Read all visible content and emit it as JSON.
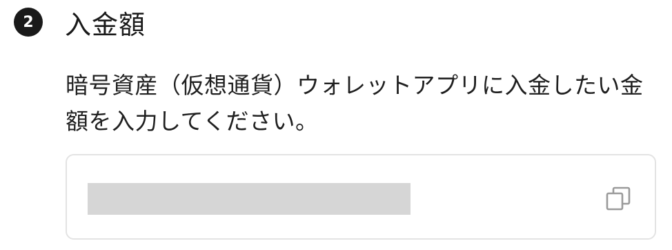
{
  "step": {
    "number": "2",
    "title": "入金額"
  },
  "instruction": "暗号資産（仮想通貨）ウォレットアプリに入金したい金額を入力してください。",
  "amount_field": {
    "value": "",
    "copy_icon": "copy-icon"
  },
  "colors": {
    "badge": "#1a1a1a",
    "border": "#e3e3e3",
    "redaction": "#d6d6d6",
    "icon": "#9a9a9a"
  }
}
